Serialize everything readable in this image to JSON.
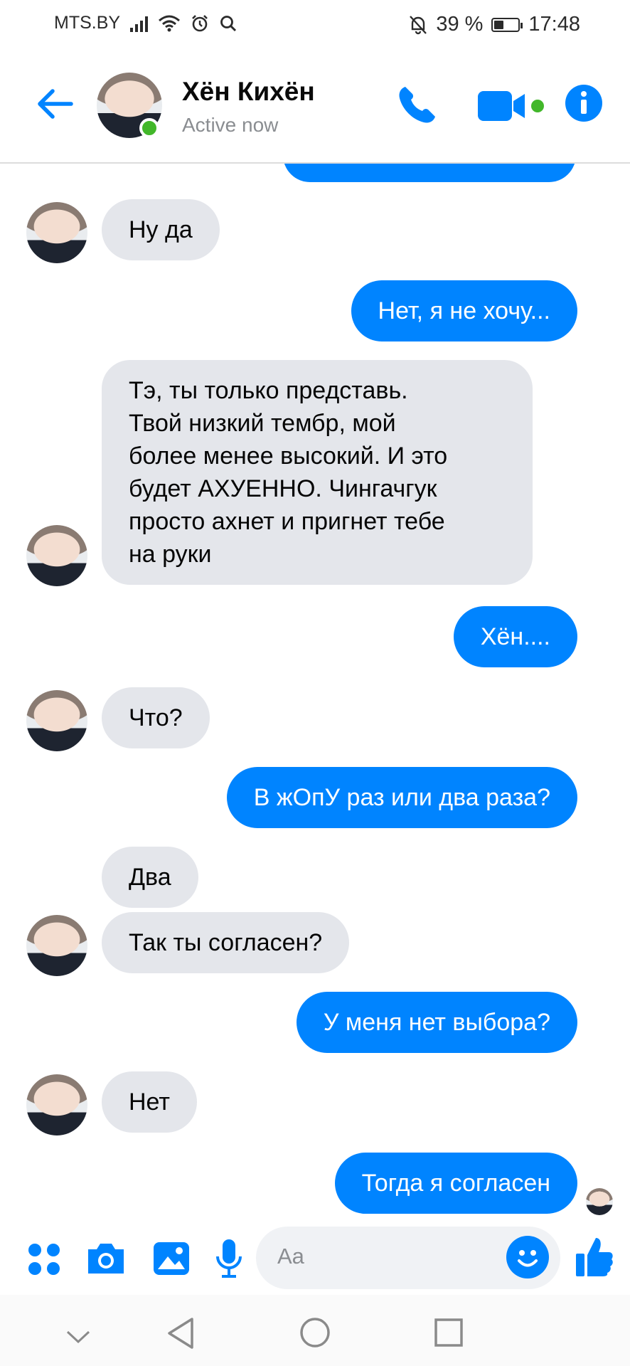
{
  "status_bar": {
    "carrier": "MTS.BY",
    "battery": "39 %",
    "battery_level": 0.39,
    "time": "17:48"
  },
  "header": {
    "contact_name": "Хён Кихён",
    "presence": "Active now"
  },
  "messages": [
    {
      "side": "in",
      "text": "Ну да"
    },
    {
      "side": "out",
      "text": "Нет, я не хочу..."
    },
    {
      "side": "in",
      "lines": [
        "Тэ, ты только представь.",
        "Твой низкий тембр, мой",
        "более менее высокий. И это",
        "будет АХУЕННО. Чингачгук",
        "просто ахнет и пригнет тебе",
        "на руки"
      ]
    },
    {
      "side": "out",
      "text": "Хён...."
    },
    {
      "side": "in",
      "text": "Что?"
    },
    {
      "side": "out",
      "text": "В жОпУ раз или два раза?"
    },
    {
      "side": "in",
      "text": "Два"
    },
    {
      "side": "in",
      "text": "Так ты согласен?"
    },
    {
      "side": "out",
      "text": "У меня нет выбора?"
    },
    {
      "side": "in",
      "text": "Нет"
    },
    {
      "side": "out",
      "text": "Тогда я согласен"
    }
  ],
  "composer": {
    "placeholder": "Aa"
  },
  "colors": {
    "accent": "#0084ff",
    "incoming_bubble": "#e4e6eb",
    "online": "#42b72a"
  },
  "icons": [
    "back-arrow-icon",
    "phone-icon",
    "video-camera-icon",
    "info-icon",
    "apps-grid-icon",
    "camera-icon",
    "gallery-icon",
    "microphone-icon",
    "emoji-icon",
    "thumbs-up-icon",
    "nav-collapse-icon",
    "nav-back-icon",
    "nav-home-icon",
    "nav-recents-icon"
  ]
}
